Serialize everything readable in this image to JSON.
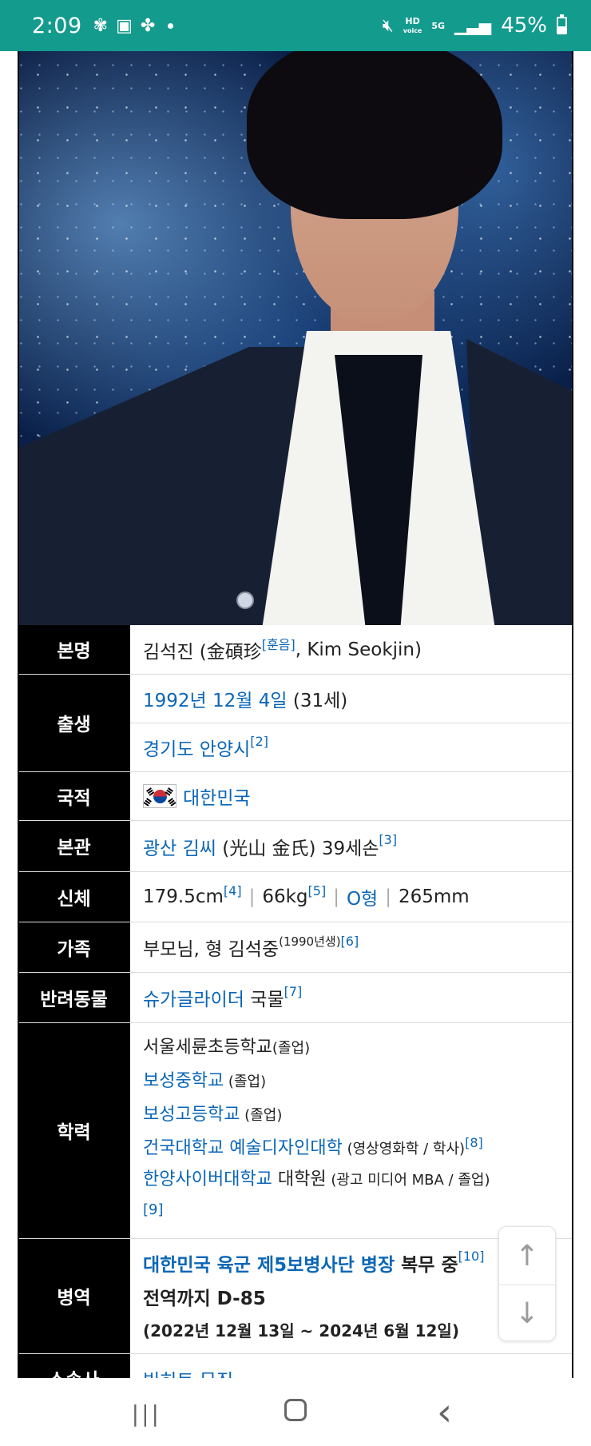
{
  "status_bar": {
    "time": "2:09",
    "left_icons": [
      "settings-gear-icon",
      "gallery-icon",
      "pinwheel-icon"
    ],
    "right_icons": [
      "mute-vibrate-icon",
      "hd-voice-icon",
      "5g-icon",
      "signal-icon",
      "battery-icon"
    ],
    "hd_label_top": "HD",
    "hd_label_bottom": "voice",
    "net_label": "5G",
    "battery_text": "45%",
    "battery_level": 0.45
  },
  "profile": {
    "photo_alt": "portrait photo",
    "rows": {
      "name": {
        "label": "본명",
        "text_pre": "김석진 (金碩珍",
        "ref": "[훈음]",
        "text_post": ", Kim Seokjin)"
      },
      "birth": {
        "label": "출생",
        "date_link": "1992년 12월 4일",
        "age": "(31세)",
        "place_link": "경기도 안양시",
        "place_ref": "[2]"
      },
      "nationality": {
        "label": "국적",
        "flag_icon": "south-korea-flag-icon",
        "country_link": "대한민국"
      },
      "clan": {
        "label": "본관",
        "clan_link": "광산 김씨",
        "clan_text": " (光山 金氏) 39세손",
        "ref": "[3]"
      },
      "body": {
        "label": "신체",
        "height": "179.5cm",
        "height_ref": "[4]",
        "weight": "66kg",
        "weight_ref": "[5]",
        "blood_link": "O형",
        "shoe": "265mm"
      },
      "family": {
        "label": "가족",
        "text": "부모님, 형 김석중",
        "born": "(1990년생)",
        "ref": "[6]"
      },
      "pet": {
        "label": "반려동물",
        "pet_link": "슈가글라이더",
        "pet_text": " 국물",
        "ref": "[7]"
      },
      "education": {
        "label": "학력",
        "items": [
          {
            "school": "서울세륜초등학교",
            "is_link": false,
            "note": "(졸업)",
            "ref": ""
          },
          {
            "school": "보성중학교",
            "is_link": true,
            "note": " (졸업)",
            "ref": ""
          },
          {
            "school": "보성고등학교",
            "is_link": true,
            "note": " (졸업)",
            "ref": ""
          },
          {
            "school": "건국대학교 예술디자인대학",
            "is_link": true,
            "note": " (영상영화학 / 학사)",
            "ref": "[8]"
          },
          {
            "school": "한양사이버대학교",
            "is_link": true,
            "extra": " 대학원",
            "note": " (광고 미디어 MBA / 졸업)",
            "ref": "[9]"
          }
        ]
      },
      "military": {
        "label": "병역",
        "unit_link": "대한민국 육군 제5보병사단 병장",
        "status": " 복무 중",
        "ref": "[10]",
        "countdown": "전역까지 D-85",
        "period": "(2022년 12월 13일 ~ 2024년 6월 12일)"
      },
      "agency": {
        "label": "소속사",
        "agency_link": "빅히트 뮤직"
      }
    }
  },
  "scroll_buttons": {
    "up_icon": "arrow-up-icon",
    "down_icon": "arrow-down-icon",
    "up": "↑",
    "down": "↓"
  },
  "nav_bar": {
    "recents": "|||",
    "back": "‹"
  }
}
